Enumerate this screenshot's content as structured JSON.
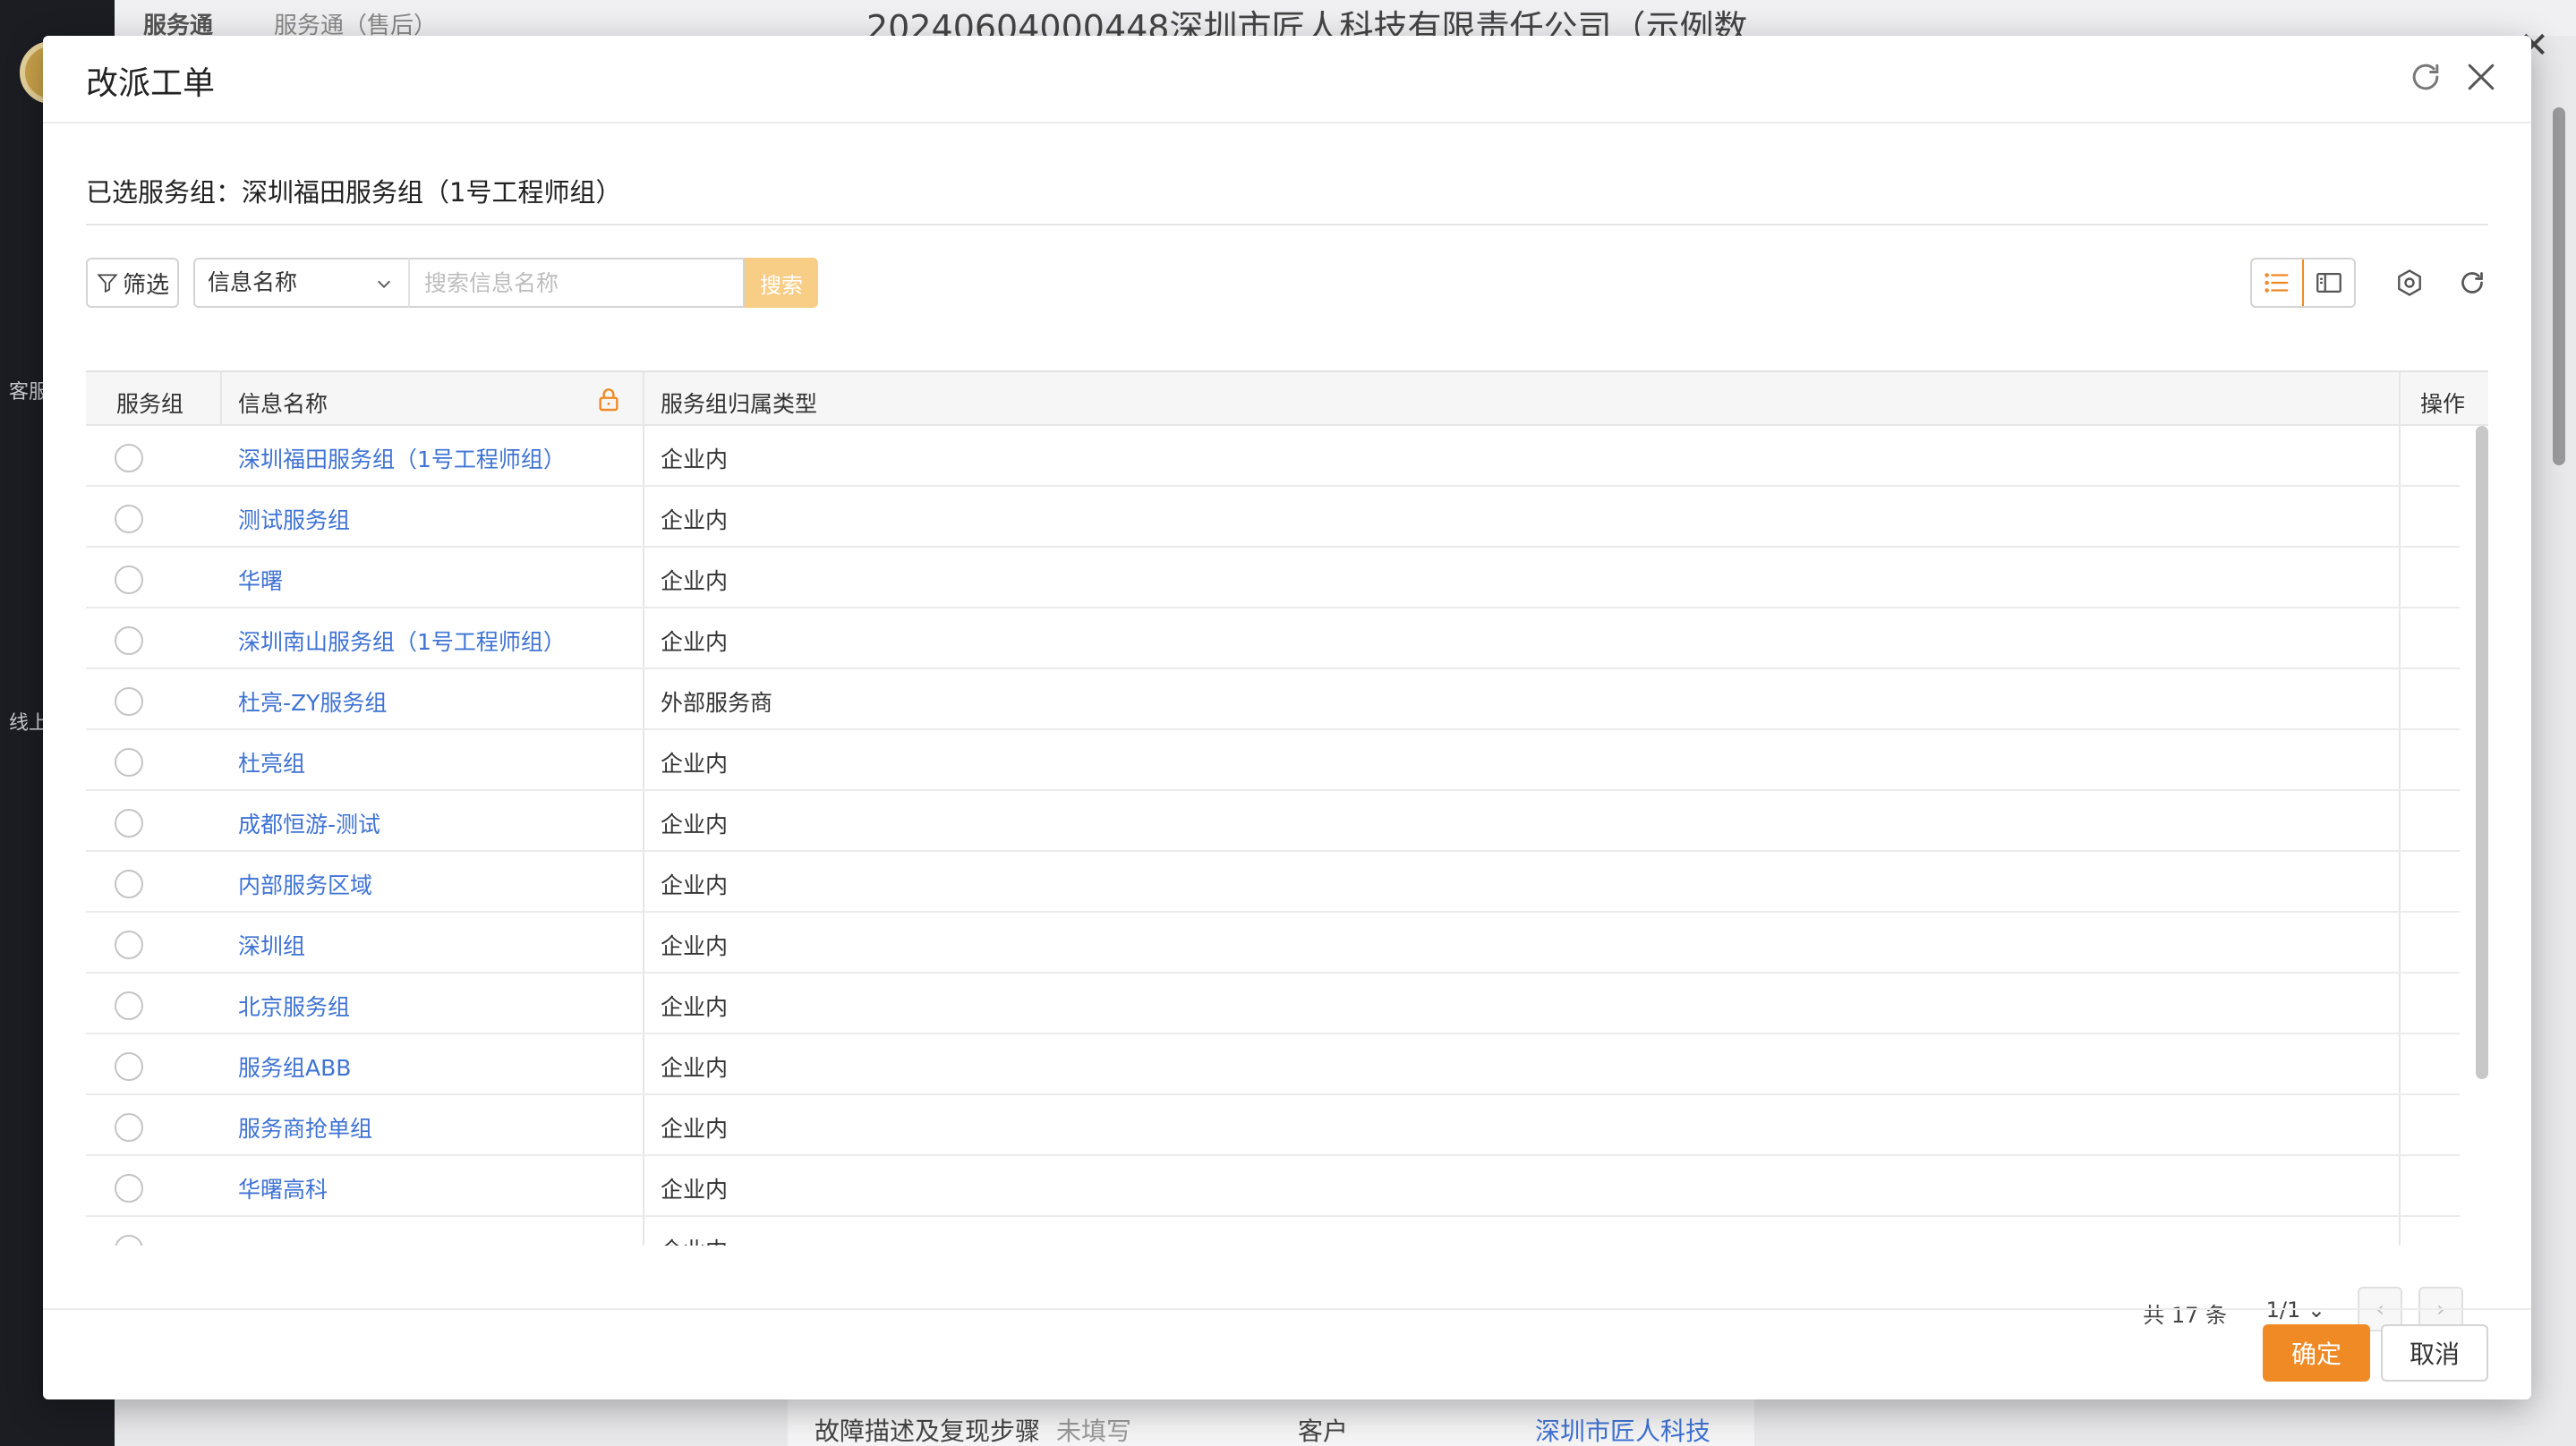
{
  "background": {
    "app_title": "服务通",
    "app_subtitle": "服务通（售后）",
    "ticket_title": "20240604000448深圳市匠人科技有限责任公司（示例数",
    "nav_labels": [
      "客服",
      "线上"
    ],
    "bottom_label": "故障描述及复现步骤",
    "bottom_value": "未填写",
    "bottom_customer_label": "客户",
    "bottom_customer_value": "深圳市匠人科技"
  },
  "modal": {
    "title": "改派工单",
    "selected_label": "已选服务组：",
    "selected_value": "深圳福田服务组（1号工程师组）",
    "toolbar": {
      "filter_label": "筛选",
      "field_select_value": "信息名称",
      "search_placeholder": "搜索信息名称",
      "search_button": "搜索"
    },
    "table": {
      "headers": {
        "col1": "服务组",
        "col2": "信息名称",
        "col3": "服务组归属类型",
        "col4": "操作"
      },
      "rows": [
        {
          "name": "深圳福田服务组（1号工程师组）",
          "type": "企业内"
        },
        {
          "name": "测试服务组",
          "type": "企业内"
        },
        {
          "name": "华曙",
          "type": "企业内"
        },
        {
          "name": "深圳南山服务组（1号工程师组）",
          "type": "企业内"
        },
        {
          "name": "杜亮-ZY服务组",
          "type": "外部服务商"
        },
        {
          "name": "杜亮组",
          "type": "企业内"
        },
        {
          "name": "成都恒游-测试",
          "type": "企业内"
        },
        {
          "name": "内部服务区域",
          "type": "企业内"
        },
        {
          "name": "深圳组",
          "type": "企业内"
        },
        {
          "name": "北京服务组",
          "type": "企业内"
        },
        {
          "name": "服务组ABB",
          "type": "企业内"
        },
        {
          "name": "服务商抢单组",
          "type": "企业内"
        },
        {
          "name": "华曙高科",
          "type": "企业内"
        },
        {
          "name": "",
          "type": "企业内"
        }
      ]
    },
    "pagination": {
      "total": "共 17 条",
      "pages": "1/1"
    },
    "footer": {
      "ok_label": "确定",
      "cancel_label": "取消"
    }
  },
  "colors": {
    "accent": "#f08a24",
    "link": "#3f73d4",
    "search_button": "#f8cd86"
  }
}
